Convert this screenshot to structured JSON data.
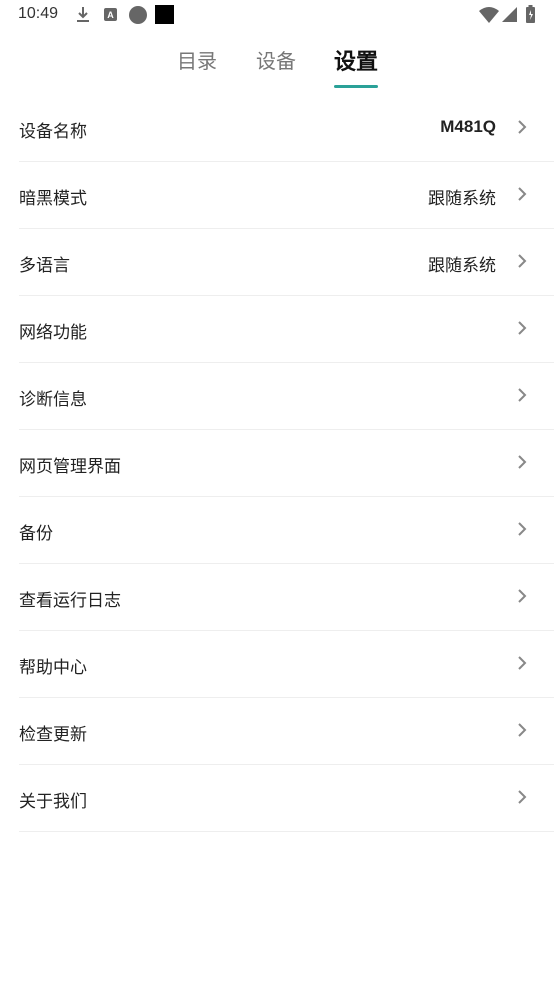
{
  "status_bar": {
    "time": "10:49",
    "icons": [
      "download-icon",
      "font-a-icon",
      "circle-icon",
      "square-icon",
      "wifi-icon",
      "signal-icon",
      "battery-icon"
    ]
  },
  "tabs": [
    {
      "label": "目录",
      "active": false
    },
    {
      "label": "设备",
      "active": false
    },
    {
      "label": "设置",
      "active": true
    }
  ],
  "accent_color": "#2aa198",
  "settings": [
    {
      "label": "设备名称",
      "value": "M481Q"
    },
    {
      "label": "暗黑模式",
      "value": "跟随系统"
    },
    {
      "label": "多语言",
      "value": "跟随系统"
    },
    {
      "label": "网络功能",
      "value": ""
    },
    {
      "label": "诊断信息",
      "value": ""
    },
    {
      "label": "网页管理界面",
      "value": ""
    },
    {
      "label": "备份",
      "value": ""
    },
    {
      "label": "查看运行日志",
      "value": ""
    },
    {
      "label": "帮助中心",
      "value": ""
    },
    {
      "label": "检查更新",
      "value": ""
    },
    {
      "label": "关于我们",
      "value": ""
    }
  ]
}
